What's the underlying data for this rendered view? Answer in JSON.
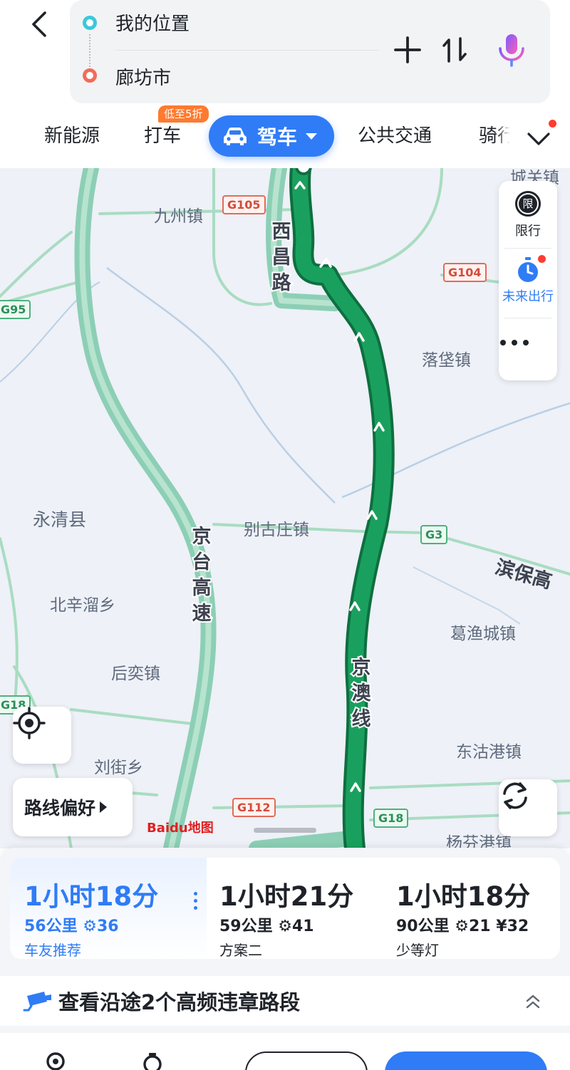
{
  "search": {
    "from": "我的位置",
    "to": "廊坊市"
  },
  "modes": {
    "tabs": [
      {
        "label": "新能源"
      },
      {
        "label": "打车"
      },
      {
        "label": "驾车"
      },
      {
        "label": "公共交通"
      },
      {
        "label": "骑行"
      }
    ],
    "discount_badge": "低至5折",
    "active_index": 2
  },
  "map": {
    "places": [
      "九州镇",
      "落垡镇",
      "永清县",
      "别古庄镇",
      "北辛溜乡",
      "葛渔城镇",
      "后奕镇",
      "东沽港镇",
      "刘街乡",
      "杨芬港镇",
      "城关镇"
    ],
    "roads": {
      "xichang": "西昌路",
      "jingtai": "京台高速",
      "jingao": "京澳线",
      "binbao": "滨保高"
    },
    "shields": [
      "G105",
      "G104",
      "G95",
      "G3",
      "G18",
      "G112",
      "G18"
    ],
    "side_panel": {
      "restriction_icon_text": "限",
      "restriction_label": "限行",
      "future_label": "未来出行"
    },
    "route_pref_label": "路线偏好",
    "logo_text": "Baidu地图",
    "route_color": "#1aa05e",
    "highway_color": "#8ccfb5"
  },
  "plans": [
    {
      "duration": "1小时18分",
      "meta": "56公里  ⚙36",
      "tag": "车友推荐",
      "selected": true
    },
    {
      "duration": "1小时21分",
      "meta": "59公里  ⚙41",
      "tag": "方案二",
      "selected": false
    },
    {
      "duration": "1小时18分",
      "meta": "90公里  ⚙21  ¥32",
      "tag": "少等灯",
      "selected": false
    }
  ],
  "violation_notice": "查看沿途2个高频违章路段",
  "accent_color": "#2f7cf6"
}
